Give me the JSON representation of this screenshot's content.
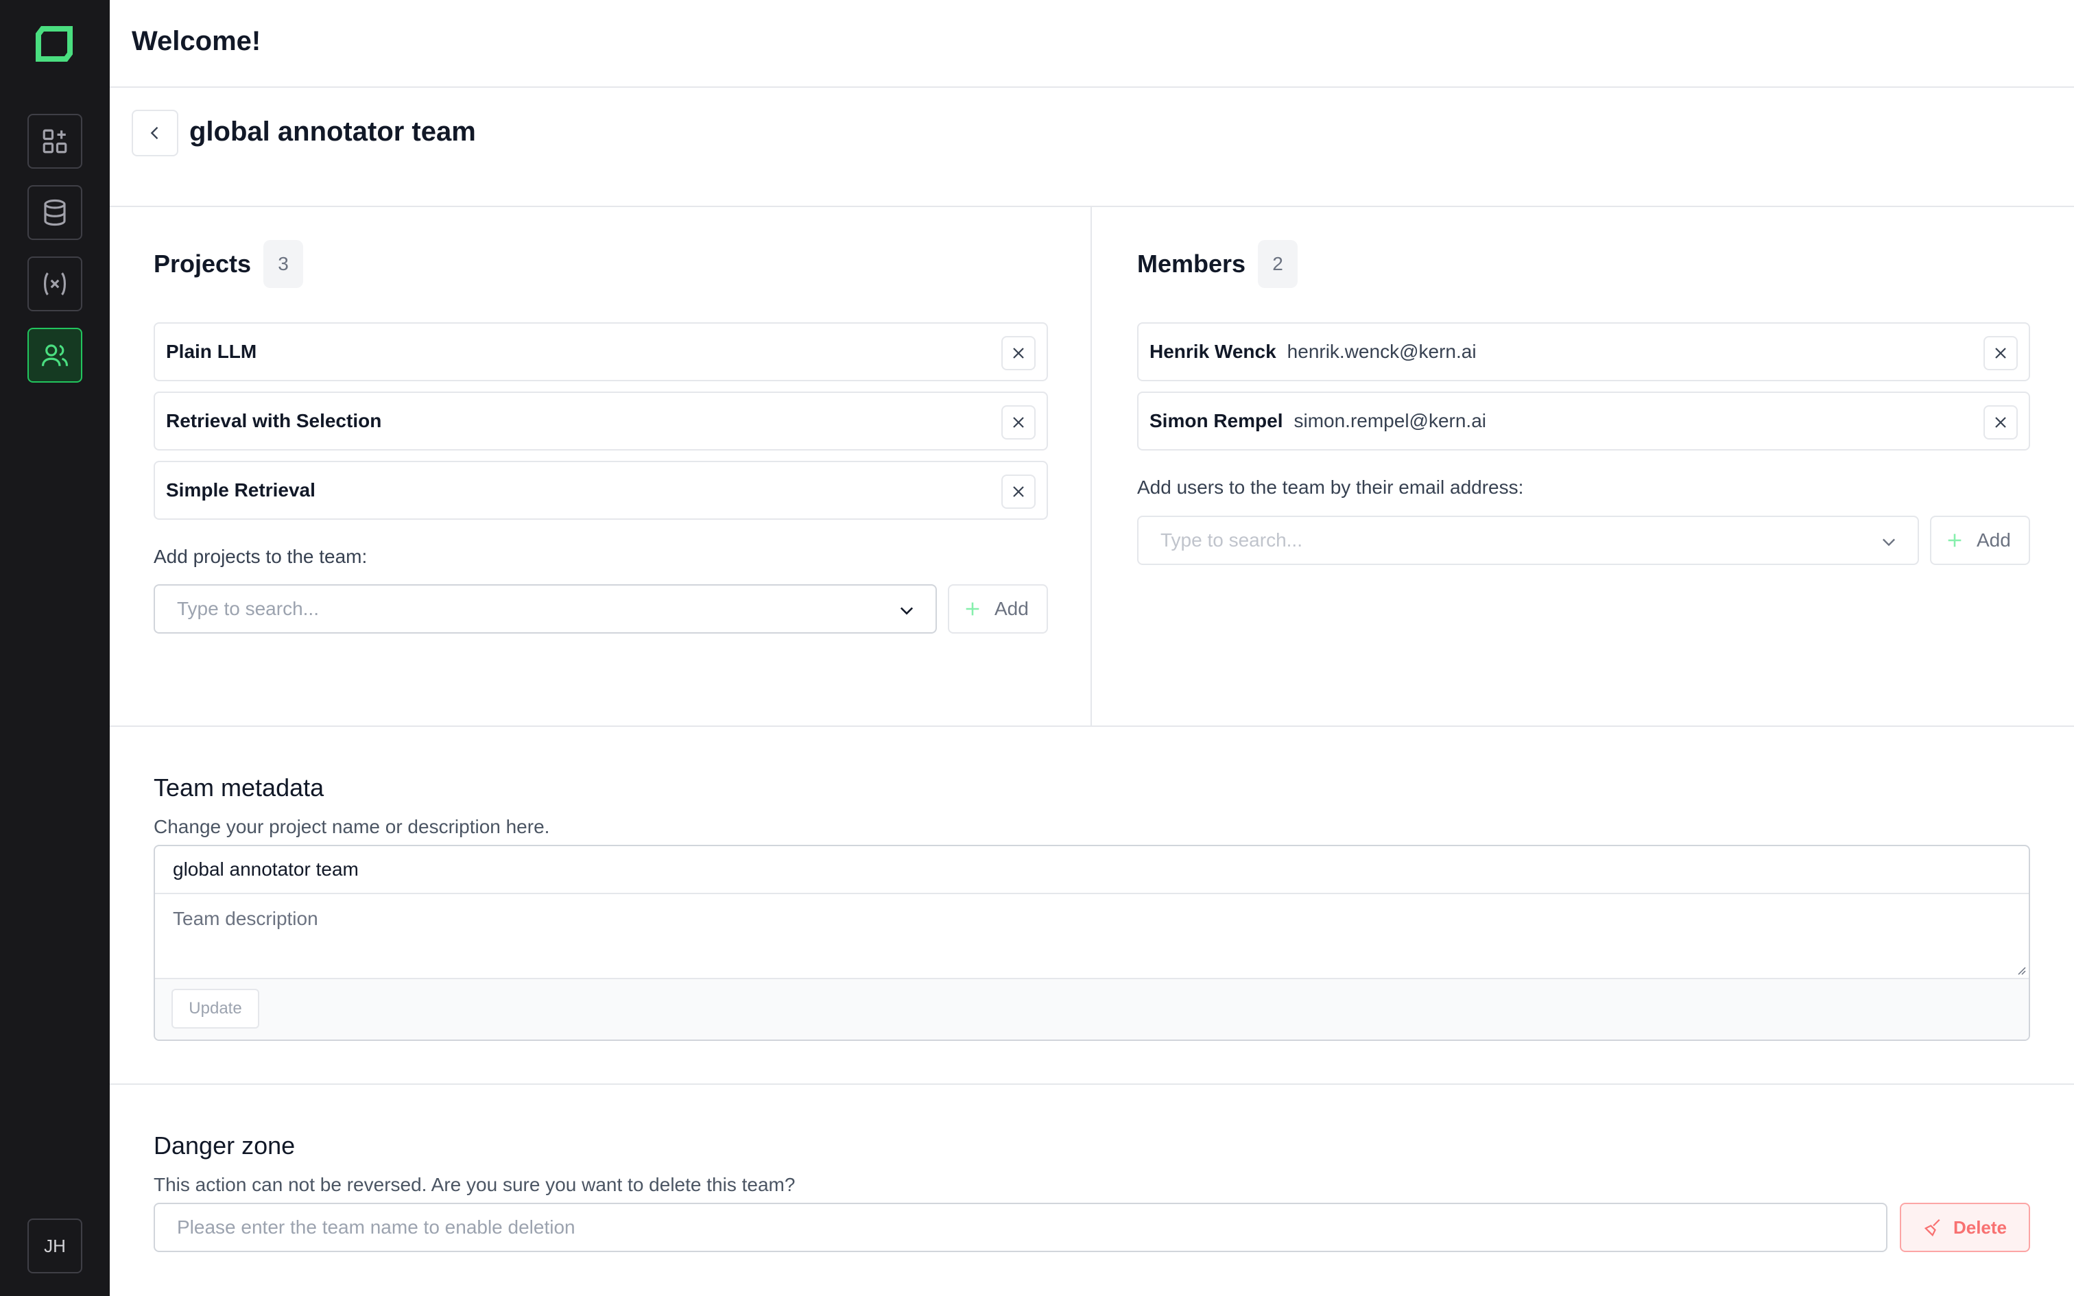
{
  "sidebar": {
    "items": [
      {
        "icon": "dashboard-add-icon",
        "active": false
      },
      {
        "icon": "database-icon",
        "active": false
      },
      {
        "icon": "variable-icon",
        "active": false
      },
      {
        "icon": "users-icon",
        "active": true
      }
    ],
    "avatar_initials": "JH"
  },
  "header": {
    "title": "Welcome!"
  },
  "page": {
    "title": "global annotator team"
  },
  "projects": {
    "heading": "Projects",
    "count": "3",
    "items": [
      {
        "name": "Plain LLM"
      },
      {
        "name": "Retrieval with Selection"
      },
      {
        "name": "Simple Retrieval"
      }
    ],
    "add_label": "Add projects to the team:",
    "search_placeholder": "Type to search...",
    "add_button": "Add"
  },
  "members": {
    "heading": "Members",
    "count": "2",
    "items": [
      {
        "name": "Henrik Wenck",
        "email": "henrik.wenck@kern.ai"
      },
      {
        "name": "Simon Rempel",
        "email": "simon.rempel@kern.ai"
      }
    ],
    "add_label": "Add users to the team by their email address:",
    "search_placeholder": "Type to search...",
    "add_button": "Add"
  },
  "metadata": {
    "heading": "Team metadata",
    "description": "Change your project name or description here.",
    "name_value": "global annotator team",
    "description_placeholder": "Team description",
    "update_button": "Update"
  },
  "danger": {
    "heading": "Danger zone",
    "description": "This action can not be reversed. Are you sure you want to delete this team?",
    "input_placeholder": "Please enter the team name to enable deletion",
    "delete_button": "Delete"
  },
  "colors": {
    "sidebar_bg": "#18181b",
    "accent_green": "#22c55e",
    "danger_red": "#f87171"
  }
}
